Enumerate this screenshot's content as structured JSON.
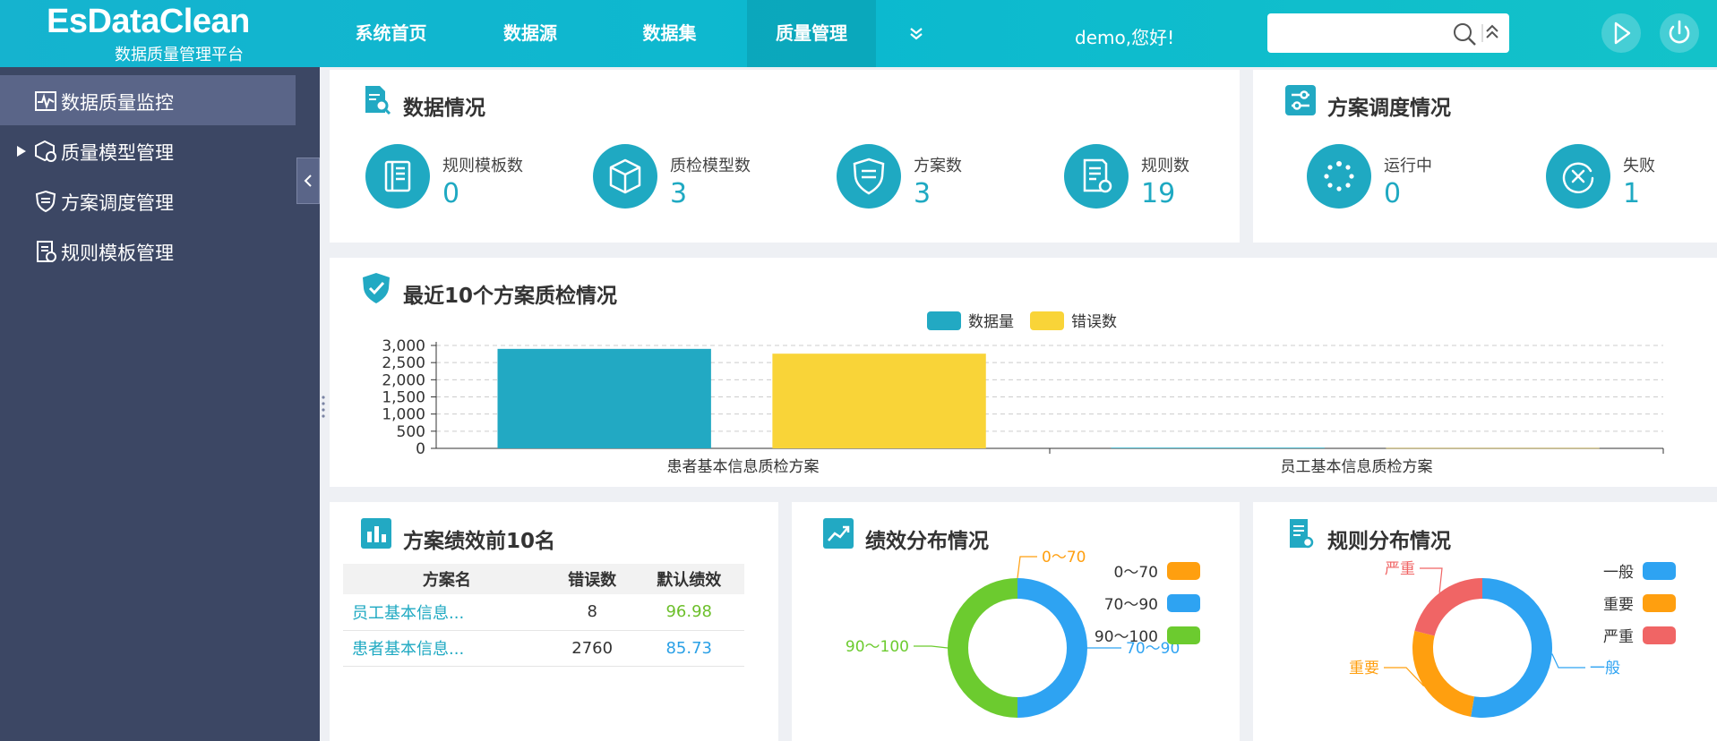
{
  "app": {
    "logo_main": "EsDataClean",
    "logo_sub": "数据质量管理平台"
  },
  "nav": [
    {
      "label": "系统首页"
    },
    {
      "label": "数据源"
    },
    {
      "label": "数据集"
    },
    {
      "label": "质量管理",
      "active": true
    }
  ],
  "header": {
    "greeting": "demo,您好!",
    "search_value": ""
  },
  "sidebar": {
    "items": [
      {
        "label": "数据质量监控",
        "icon": "monitor-icon",
        "active": true
      },
      {
        "label": "质量模型管理",
        "icon": "model-icon",
        "expandable": true
      },
      {
        "label": "方案调度管理",
        "icon": "shield-icon"
      },
      {
        "label": "规则模板管理",
        "icon": "template-icon"
      }
    ]
  },
  "data_overview": {
    "title": "数据情况",
    "stats": [
      {
        "label": "规则模板数",
        "value": "0",
        "icon": "book-icon"
      },
      {
        "label": "质检模型数",
        "value": "3",
        "icon": "cube-icon"
      },
      {
        "label": "方案数",
        "value": "3",
        "icon": "shield-icon"
      },
      {
        "label": "规则数",
        "value": "19",
        "icon": "doc-gear-icon"
      }
    ]
  },
  "schedule": {
    "title": "方案调度情况",
    "stats": [
      {
        "label": "运行中",
        "value": "0",
        "icon": "spinner-icon"
      },
      {
        "label": "失败",
        "value": "1",
        "icon": "fail-icon"
      }
    ]
  },
  "recent_chart": {
    "title": "最近10个方案质检情况",
    "legend": [
      "数据量",
      "错误数"
    ]
  },
  "chart_data": [
    {
      "type": "bar",
      "title": "最近10个方案质检情况",
      "categories": [
        "患者基本信息质检方案",
        "员工基本信息质检方案"
      ],
      "series": [
        {
          "name": "数据量",
          "values": [
            2900,
            20
          ],
          "color": "#22a9c3"
        },
        {
          "name": "错误数",
          "values": [
            2760,
            8
          ],
          "color": "#f9d438"
        }
      ],
      "yticks": [
        "0",
        "500",
        "1,000",
        "1,500",
        "2,000",
        "2,500",
        "3,000"
      ],
      "ylim": [
        0,
        3000
      ],
      "grid": true,
      "legend_position": "top-center"
    },
    {
      "type": "pie",
      "title": "绩效分布情况",
      "labels": [
        "0～70",
        "70～90",
        "90～100"
      ],
      "values": [
        0,
        1,
        1
      ],
      "colors": [
        "#ff9f0f",
        "#2ea3f2",
        "#6ccb2f"
      ],
      "legend_position": "right"
    },
    {
      "type": "pie",
      "title": "规则分布情况",
      "labels": [
        "一般",
        "重要",
        "严重"
      ],
      "values": [
        10,
        5,
        4
      ],
      "colors": [
        "#2ea3f2",
        "#ff9f0f",
        "#f06565"
      ],
      "legend_position": "right"
    }
  ],
  "ranking": {
    "title": "方案绩效前10名",
    "headers": [
      "方案名",
      "错误数",
      "默认绩效"
    ],
    "rows": [
      {
        "name": "员工基本信息...",
        "errors": "8",
        "score": "96.98"
      },
      {
        "name": "患者基本信息...",
        "errors": "2760",
        "score": "85.73"
      }
    ]
  },
  "perf_dist": {
    "title": "绩效分布情况"
  },
  "rule_dist": {
    "title": "规则分布情况"
  }
}
